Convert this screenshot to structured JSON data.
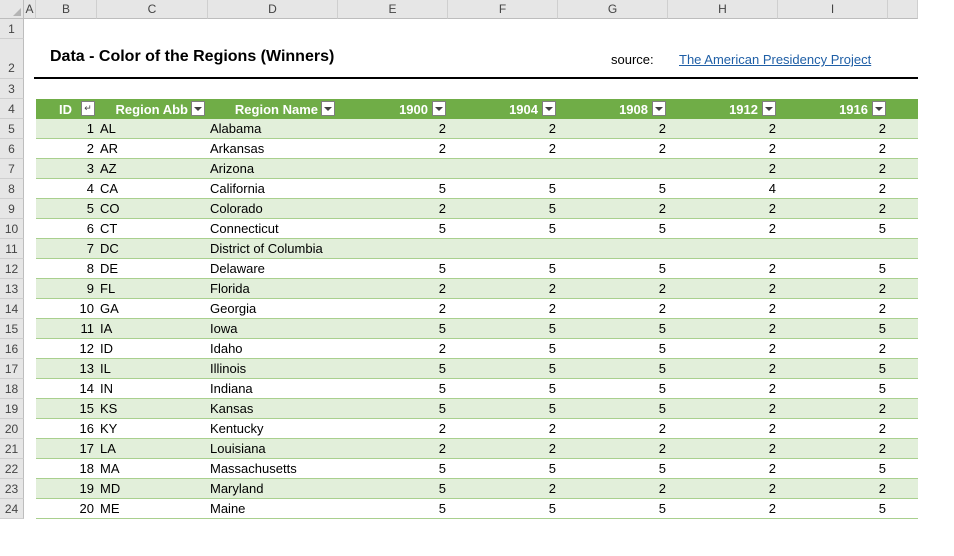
{
  "columns": [
    "A",
    "B",
    "C",
    "D",
    "E",
    "F",
    "G",
    "H",
    "I"
  ],
  "row_numbers": [
    "1",
    "2",
    "3",
    "4",
    "5",
    "6",
    "7",
    "8",
    "9",
    "10",
    "11",
    "12",
    "13",
    "14",
    "15",
    "16",
    "17",
    "18",
    "19",
    "20",
    "21",
    "22",
    "23",
    "24"
  ],
  "title": "Data - Color of the Regions (Winners)",
  "source_label": "source:",
  "source_link": "The American Presidency Project",
  "headers": [
    "ID",
    "Region Abb",
    "Region Name",
    "1900",
    "1904",
    "1908",
    "1912",
    "1916"
  ],
  "rows": [
    [
      "1",
      "AL",
      "Alabama",
      "2",
      "2",
      "2",
      "2",
      "2"
    ],
    [
      "2",
      "AR",
      "Arkansas",
      "2",
      "2",
      "2",
      "2",
      "2"
    ],
    [
      "3",
      "AZ",
      "Arizona",
      "",
      "",
      "",
      "2",
      "2"
    ],
    [
      "4",
      "CA",
      "California",
      "5",
      "5",
      "5",
      "4",
      "2"
    ],
    [
      "5",
      "CO",
      "Colorado",
      "2",
      "5",
      "2",
      "2",
      "2"
    ],
    [
      "6",
      "CT",
      "Connecticut",
      "5",
      "5",
      "5",
      "2",
      "5"
    ],
    [
      "7",
      "DC",
      "District of Columbia",
      "",
      "",
      "",
      "",
      ""
    ],
    [
      "8",
      "DE",
      "Delaware",
      "5",
      "5",
      "5",
      "2",
      "5"
    ],
    [
      "9",
      "FL",
      "Florida",
      "2",
      "2",
      "2",
      "2",
      "2"
    ],
    [
      "10",
      "GA",
      "Georgia",
      "2",
      "2",
      "2",
      "2",
      "2"
    ],
    [
      "11",
      "IA",
      "Iowa",
      "5",
      "5",
      "5",
      "2",
      "5"
    ],
    [
      "12",
      "ID",
      "Idaho",
      "2",
      "5",
      "5",
      "2",
      "2"
    ],
    [
      "13",
      "IL",
      "Illinois",
      "5",
      "5",
      "5",
      "2",
      "5"
    ],
    [
      "14",
      "IN",
      "Indiana",
      "5",
      "5",
      "5",
      "2",
      "5"
    ],
    [
      "15",
      "KS",
      "Kansas",
      "5",
      "5",
      "5",
      "2",
      "2"
    ],
    [
      "16",
      "KY",
      "Kentucky",
      "2",
      "2",
      "2",
      "2",
      "2"
    ],
    [
      "17",
      "LA",
      "Louisiana",
      "2",
      "2",
      "2",
      "2",
      "2"
    ],
    [
      "18",
      "MA",
      "Massachusetts",
      "5",
      "5",
      "5",
      "2",
      "5"
    ],
    [
      "19",
      "MD",
      "Maryland",
      "5",
      "2",
      "2",
      "2",
      "2"
    ],
    [
      "20",
      "ME",
      "Maine",
      "5",
      "5",
      "5",
      "2",
      "5"
    ]
  ],
  "colors": {
    "header_green": "#70ad47",
    "band_green": "#e2efda",
    "link_blue": "#1f5fa6"
  }
}
